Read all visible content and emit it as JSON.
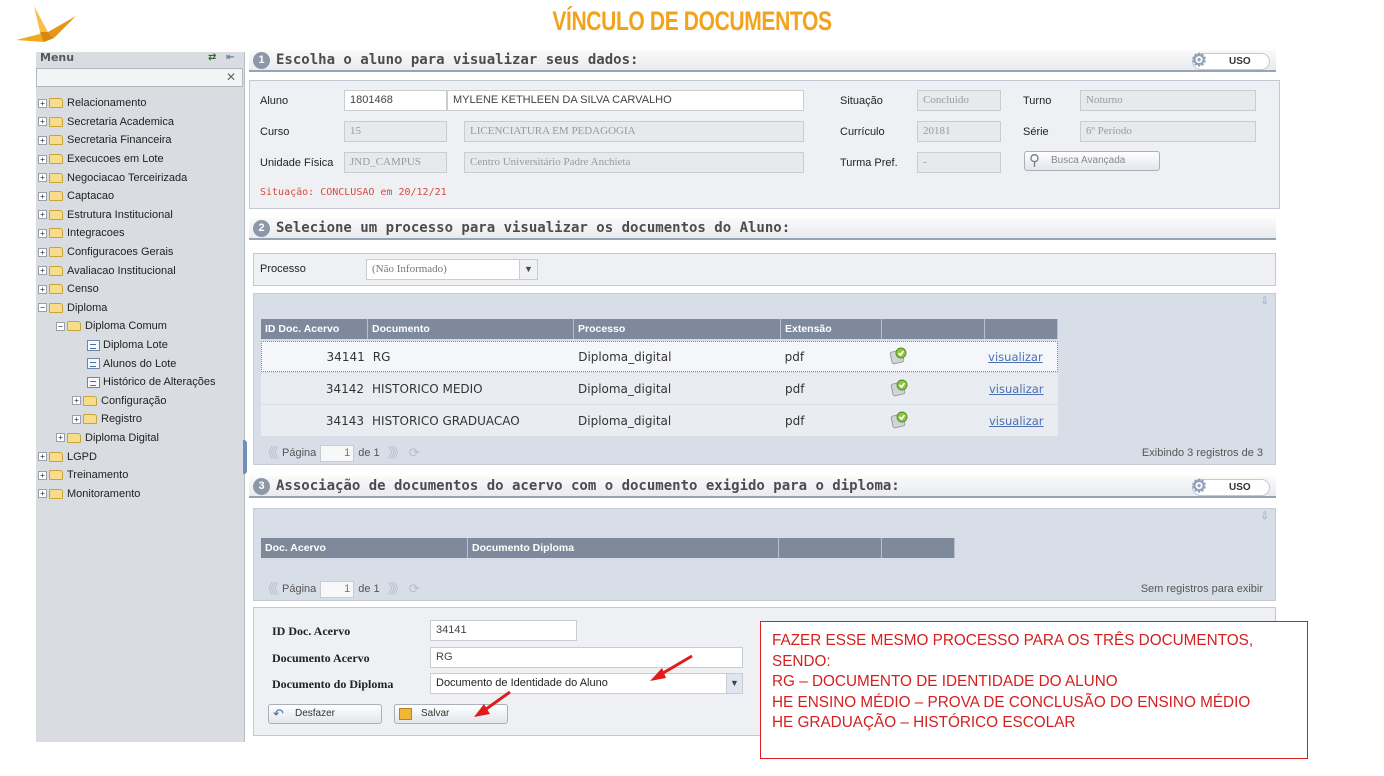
{
  "header": {
    "title": "VÍNCULO DE DOCUMENTOS"
  },
  "sidebar": {
    "title": "Menu",
    "search_value": "",
    "items": [
      {
        "label": "Relacionamento",
        "level": 0,
        "type": "folder",
        "expanded": false
      },
      {
        "label": "Secretaria Academica",
        "level": 0,
        "type": "folder",
        "expanded": false
      },
      {
        "label": "Secretaria Financeira",
        "level": 0,
        "type": "folder",
        "expanded": false
      },
      {
        "label": "Execucoes em Lote",
        "level": 0,
        "type": "folder",
        "expanded": false
      },
      {
        "label": "Negociacao Terceirizada",
        "level": 0,
        "type": "folder",
        "expanded": false
      },
      {
        "label": "Captacao",
        "level": 0,
        "type": "folder",
        "expanded": false
      },
      {
        "label": "Estrutura Institucional",
        "level": 0,
        "type": "folder",
        "expanded": false
      },
      {
        "label": "Integracoes",
        "level": 0,
        "type": "folder",
        "expanded": false
      },
      {
        "label": "Configuracoes Gerais",
        "level": 0,
        "type": "folder",
        "expanded": false
      },
      {
        "label": "Avaliacao Institucional",
        "level": 0,
        "type": "folder",
        "expanded": false
      },
      {
        "label": "Censo",
        "level": 0,
        "type": "folder",
        "expanded": false
      },
      {
        "label": "Diploma",
        "level": 0,
        "type": "folder",
        "expanded": true
      },
      {
        "label": "Diploma Comum",
        "level": 1,
        "type": "folder",
        "expanded": true
      },
      {
        "label": "Diploma Lote",
        "level": 2,
        "type": "page"
      },
      {
        "label": "Alunos do Lote",
        "level": 2,
        "type": "page"
      },
      {
        "label": "Histórico de Alterações",
        "level": 2,
        "type": "page"
      },
      {
        "label": "Configuração",
        "level": 2,
        "type": "folder",
        "expanded": false
      },
      {
        "label": "Registro",
        "level": 2,
        "type": "folder",
        "expanded": false
      },
      {
        "label": "Diploma Digital",
        "level": 1,
        "type": "folder",
        "expanded": false
      },
      {
        "label": "LGPD",
        "level": 0,
        "type": "folder",
        "expanded": false
      },
      {
        "label": "Treinamento",
        "level": 0,
        "type": "folder",
        "expanded": false
      },
      {
        "label": "Monitoramento",
        "level": 0,
        "type": "folder",
        "expanded": false
      }
    ]
  },
  "section1": {
    "number": "1",
    "title": "Escolha o aluno para visualizar seus dados:",
    "uso": "USO",
    "aluno_label": "Aluno",
    "aluno_code": "1801468",
    "aluno_name": "MYLENE KETHLEEN DA SILVA CARVALHO",
    "situacao_label": "Situação",
    "situacao_value": "Concluido",
    "turno_label": "Turno",
    "turno_value": "Noturno",
    "curso_label": "Curso",
    "curso_code": "15",
    "curso_name": "LICENCIATURA EM PEDAGOGIA",
    "curriculo_label": "Currículo",
    "curriculo_value": "20181",
    "serie_label": "Série",
    "serie_value": "6º Período",
    "unidade_label": "Unidade Física",
    "unidade_code": "JND_CAMPUS",
    "unidade_name": "Centro Universitário Padre Anchieta",
    "turma_label": "Turma Pref.",
    "turma_value": "-",
    "busca_button": "Busca Avançada",
    "status_text": "Situação: CONCLUSAO em 20/12/21"
  },
  "section2": {
    "number": "2",
    "title": "Selecione um processo para visualizar os documentos do Aluno:",
    "processo_label": "Processo",
    "processo_value": "(Não Informado)",
    "columns": [
      "ID Doc. Acervo",
      "Documento",
      "Processo",
      "Extensão",
      "",
      ""
    ],
    "rows": [
      {
        "id": "34141",
        "documento": "RG",
        "processo": "Diploma_digital",
        "extensao": "pdf",
        "action": "visualizar"
      },
      {
        "id": "34142",
        "documento": "HISTORICO MEDIO",
        "processo": "Diploma_digital",
        "extensao": "pdf",
        "action": "visualizar"
      },
      {
        "id": "34143",
        "documento": "HISTORICO GRADUACAO",
        "processo": "Diploma_digital",
        "extensao": "pdf",
        "action": "visualizar"
      }
    ],
    "pager": {
      "label": "Página",
      "page": "1",
      "of": "de 1",
      "summary": "Exibindo 3 registros de 3"
    }
  },
  "section3": {
    "number": "3",
    "title": "Associação de documentos do acervo com o documento exigido para o diploma:",
    "uso": "USO",
    "columns": [
      "Doc. Acervo",
      "Documento Diploma",
      "",
      ""
    ],
    "pager": {
      "label": "Página",
      "page": "1",
      "of": "de 1",
      "summary": "Sem registros para exibir"
    },
    "form": {
      "id_label": "ID Doc. Acervo",
      "id_value": "34141",
      "doc_label": "Documento Acervo",
      "doc_value": "RG",
      "dip_label": "Documento do Diploma",
      "dip_value": "Documento de Identidade do Aluno",
      "undo_button": "Desfazer",
      "save_button": "Salvar"
    }
  },
  "note": {
    "lines": [
      "FAZER ESSE MESMO PROCESSO PARA OS TRÊS DOCUMENTOS,",
      "SENDO:",
      "RG – DOCUMENTO DE IDENTIDADE DO ALUNO",
      "HE ENSINO MÉDIO – PROVA DE CONCLUSÃO DO ENSINO MÉDIO",
      "HE GRADUAÇÃO – HISTÓRICO ESCOLAR"
    ],
    "color": "#d42020"
  },
  "colors": {
    "accent": "#f3a31b",
    "header_bar": "#7e8a9c",
    "link": "#4a6fb5"
  }
}
